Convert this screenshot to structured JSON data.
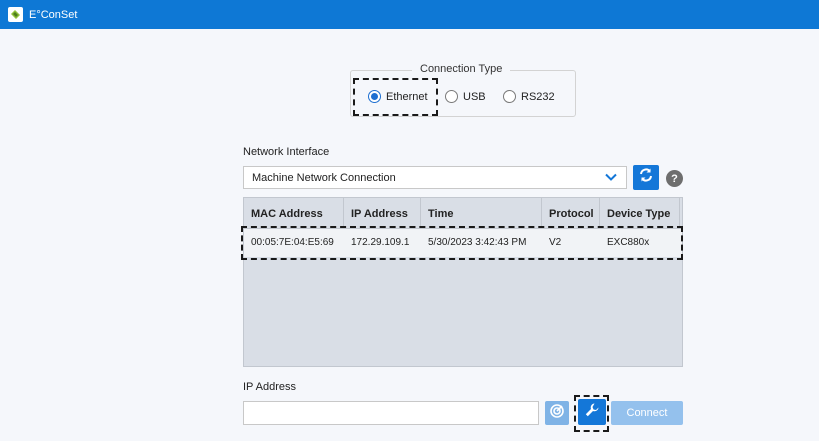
{
  "window": {
    "title": "E°ConSet"
  },
  "connection": {
    "legend": "Connection Type",
    "options": [
      {
        "label": "Ethernet",
        "checked": true
      },
      {
        "label": "USB",
        "checked": false
      },
      {
        "label": "RS232",
        "checked": false
      }
    ]
  },
  "network": {
    "label": "Network Interface",
    "selected": "Machine Network Connection",
    "help": "?"
  },
  "table": {
    "columns": [
      "MAC Address",
      "IP Address",
      "Time",
      "Protocol",
      "Device Type"
    ],
    "rows": [
      [
        "00:05:7E:04:E5:69",
        "172.29.109.1",
        "5/30/2023 3:42:43 PM",
        "V2",
        "EXC880x"
      ]
    ]
  },
  "ip": {
    "label": "IP Address",
    "value": "",
    "connect_label": "Connect"
  },
  "colors": {
    "accent": "#1477d8",
    "titlebar": "#0e78d5",
    "disabled_button": "#94c1ed"
  }
}
